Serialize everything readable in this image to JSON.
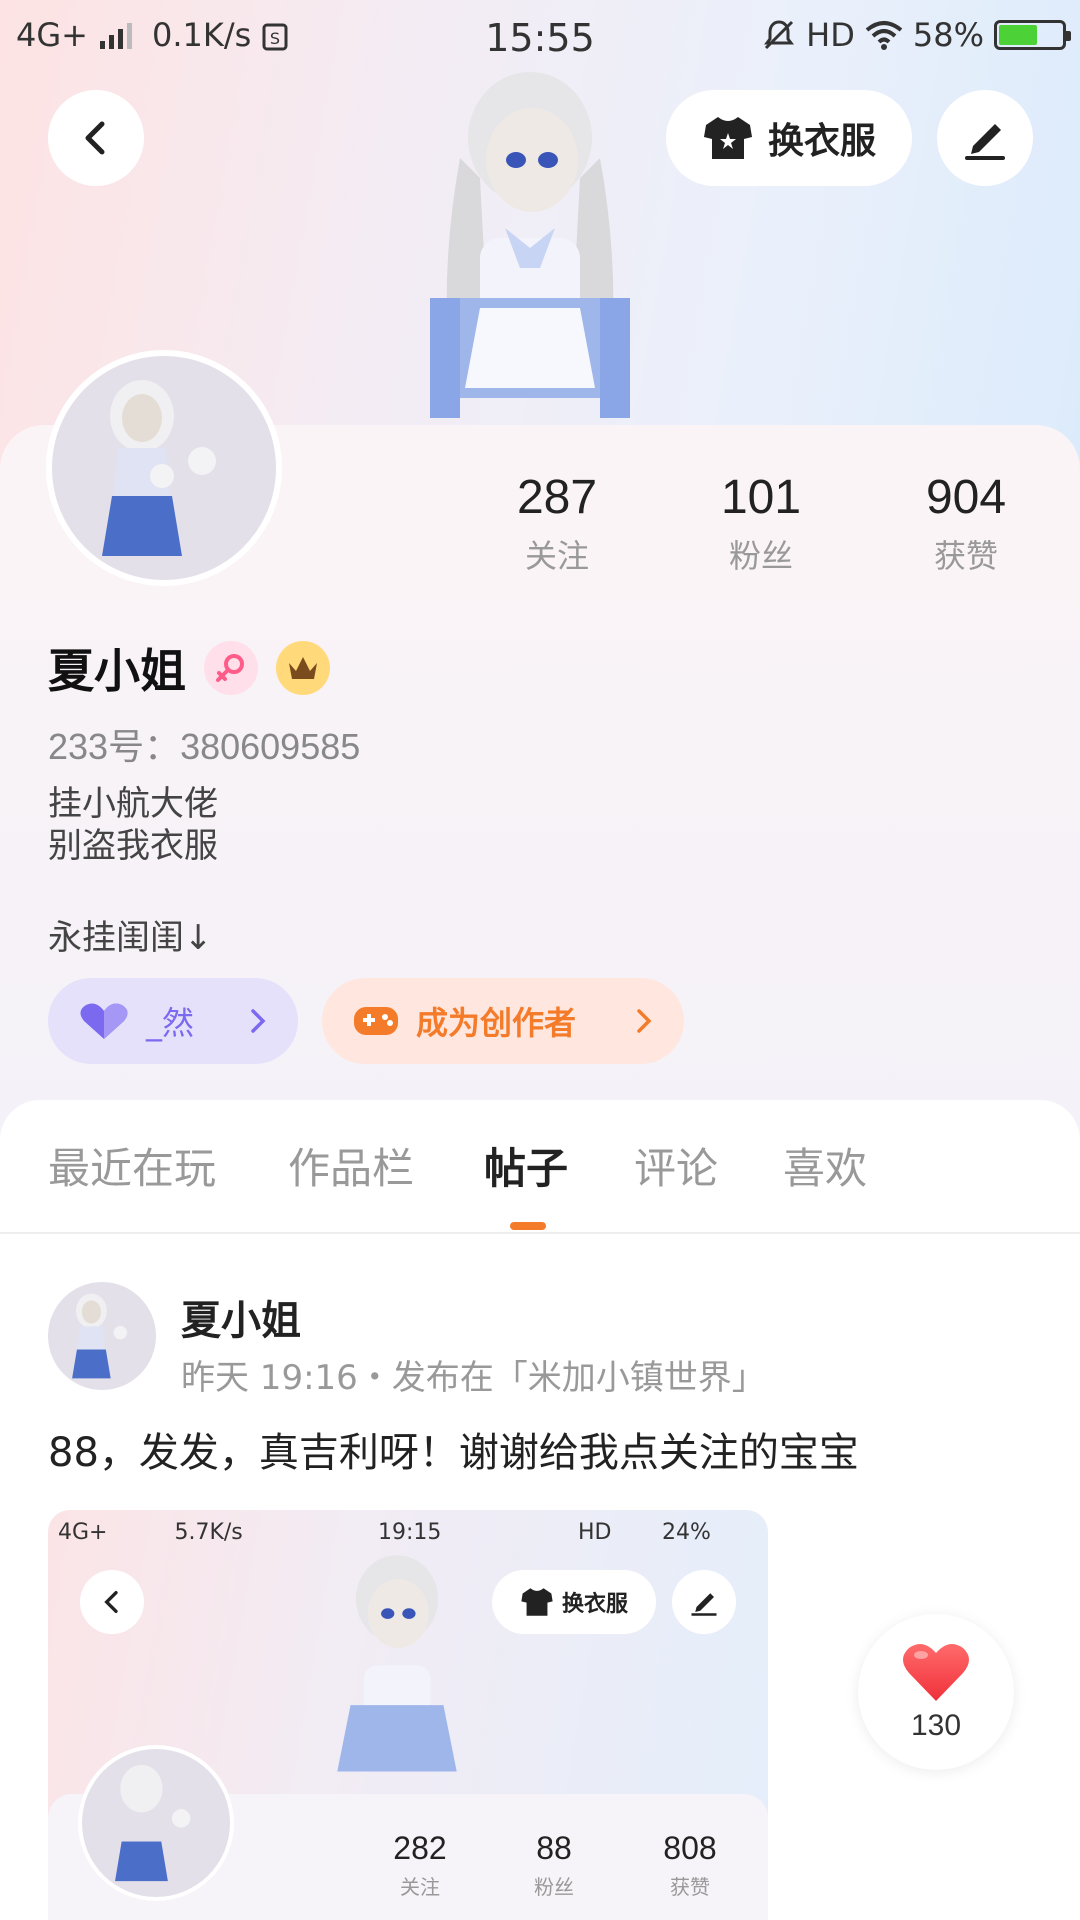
{
  "status_bar": {
    "network": "4G+",
    "speed": "0.1K/s",
    "time": "15:55",
    "hd": "HD",
    "battery": "58%"
  },
  "header": {
    "outfit_label": "换衣服"
  },
  "profile": {
    "stats": [
      {
        "value": "287",
        "label": "关注"
      },
      {
        "value": "101",
        "label": "粉丝"
      },
      {
        "value": "904",
        "label": "获赞"
      }
    ],
    "name": "夏小姐",
    "uid": "233号：380609585",
    "bio_line1": "挂小航大佬",
    "bio_line2": "别盗我衣服",
    "bio_line3": "永挂闺闺↓",
    "friend_pill": "_然",
    "creator_pill": "成为创作者"
  },
  "tabs": [
    "最近在玩",
    "作品栏",
    "帖子",
    "评论",
    "喜欢"
  ],
  "active_tab": "帖子",
  "post": {
    "author": "夏小姐",
    "meta": "昨天 19:16・发布在「米加小镇世界」",
    "text": "88，发发，真吉利呀！谢谢给我点关注的宝宝",
    "likes": "130",
    "image": {
      "status_network": "4G+",
      "status_speed": "5.7K/s",
      "status_time": "19:15",
      "status_hd": "HD",
      "status_battery": "24%",
      "outfit_label": "换衣服",
      "stats": [
        {
          "value": "282",
          "label": "关注"
        },
        {
          "value": "88",
          "label": "粉丝"
        },
        {
          "value": "808",
          "label": "获赞"
        }
      ]
    }
  },
  "colors": {
    "accent_orange": "#f37b2a",
    "friend_purple": "#7b6af0",
    "heart_red": "#ff4b4b"
  }
}
